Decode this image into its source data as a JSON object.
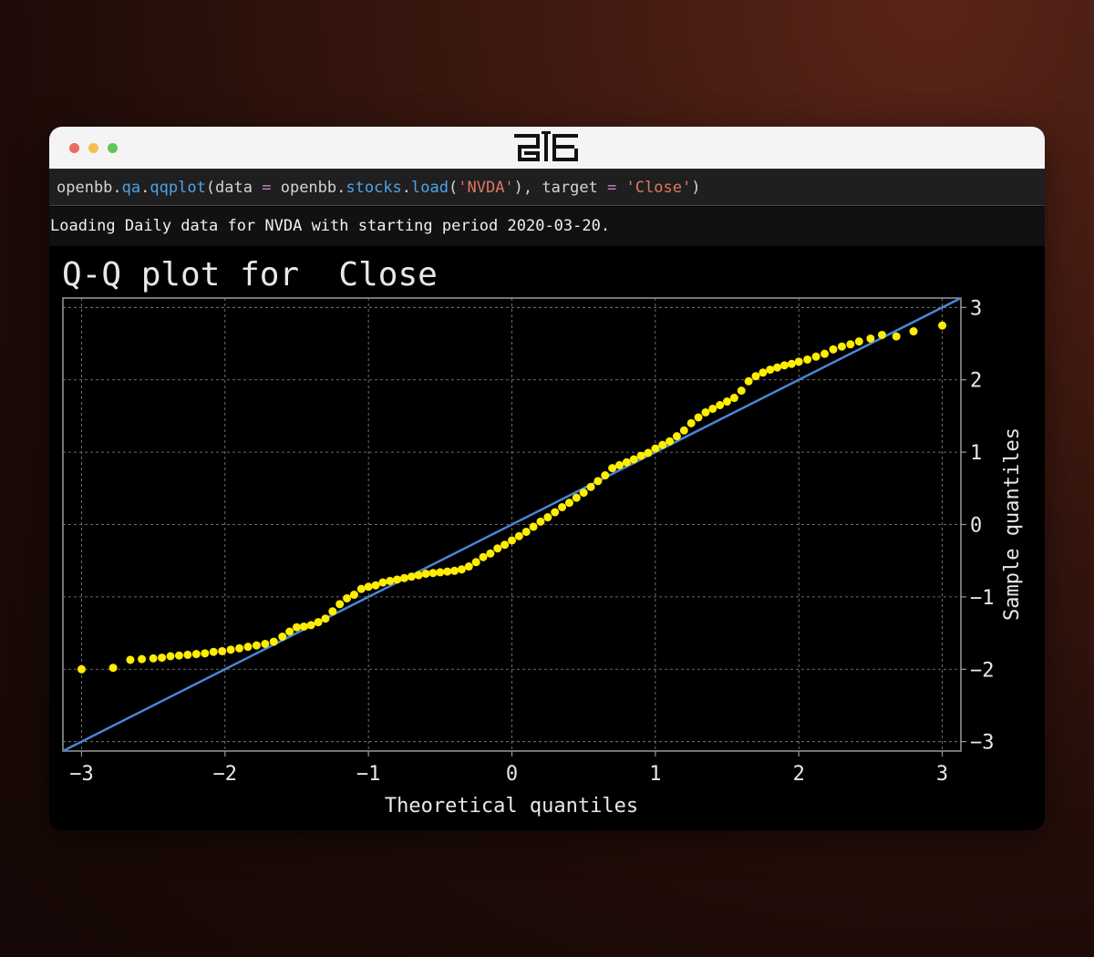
{
  "window": {
    "logo": "openbb-logo-icon"
  },
  "code": {
    "t1": "openbb.",
    "t2": "qa",
    "t3": ".",
    "t4": "qqplot",
    "t5": "(data ",
    "t6": "=",
    "t7": " openbb.",
    "t8": "stocks",
    "t9": ".",
    "t10": "load",
    "t11": "(",
    "t12": "'NVDA'",
    "t13": "), target ",
    "t14": "=",
    "t15": " ",
    "t16": "'Close'",
    "t17": ")"
  },
  "output": {
    "message": "Loading Daily data for NVDA with starting period 2020-03-20."
  },
  "colors": {
    "points": "#ffee00",
    "line": "#4a86d4",
    "grid": "#8a8a8a",
    "axis_text": "#e8e8e8"
  },
  "chart_data": {
    "type": "scatter",
    "title": "Q-Q plot for  Close",
    "xlabel": "Theoretical quantiles",
    "ylabel": "Sample quantiles",
    "xlim": [
      -3.13,
      3.13
    ],
    "ylim": [
      -3.13,
      3.13
    ],
    "xticks": [
      -3,
      -2,
      -1,
      0,
      1,
      2,
      3
    ],
    "yticks": [
      -3,
      -2,
      -1,
      0,
      1,
      2,
      3
    ],
    "xtick_labels": [
      "−3",
      "−2",
      "−1",
      "0",
      "1",
      "2",
      "3"
    ],
    "ytick_labels": [
      "−3",
      "−2",
      "−1",
      "0",
      "1",
      "2",
      "3"
    ],
    "grid": true,
    "y_axis_side": "right",
    "reference_line": {
      "x": [
        -3.13,
        3.13
      ],
      "y": [
        -3.13,
        3.13
      ]
    },
    "points": [
      [
        -3.0,
        -2.0
      ],
      [
        -2.78,
        -1.98
      ],
      [
        -2.66,
        -1.87
      ],
      [
        -2.58,
        -1.86
      ],
      [
        -2.5,
        -1.85
      ],
      [
        -2.44,
        -1.84
      ],
      [
        -2.38,
        -1.82
      ],
      [
        -2.32,
        -1.81
      ],
      [
        -2.26,
        -1.8
      ],
      [
        -2.2,
        -1.79
      ],
      [
        -2.14,
        -1.78
      ],
      [
        -2.08,
        -1.76
      ],
      [
        -2.02,
        -1.75
      ],
      [
        -1.96,
        -1.73
      ],
      [
        -1.9,
        -1.71
      ],
      [
        -1.84,
        -1.69
      ],
      [
        -1.78,
        -1.67
      ],
      [
        -1.72,
        -1.65
      ],
      [
        -1.66,
        -1.62
      ],
      [
        -1.6,
        -1.55
      ],
      [
        -1.55,
        -1.48
      ],
      [
        -1.5,
        -1.42
      ],
      [
        -1.45,
        -1.41
      ],
      [
        -1.4,
        -1.39
      ],
      [
        -1.35,
        -1.35
      ],
      [
        -1.3,
        -1.3
      ],
      [
        -1.25,
        -1.2
      ],
      [
        -1.2,
        -1.1
      ],
      [
        -1.15,
        -1.02
      ],
      [
        -1.1,
        -0.97
      ],
      [
        -1.05,
        -0.89
      ],
      [
        -1.0,
        -0.86
      ],
      [
        -0.95,
        -0.84
      ],
      [
        -0.9,
        -0.8
      ],
      [
        -0.85,
        -0.78
      ],
      [
        -0.8,
        -0.76
      ],
      [
        -0.75,
        -0.74
      ],
      [
        -0.7,
        -0.72
      ],
      [
        -0.65,
        -0.7
      ],
      [
        -0.6,
        -0.68
      ],
      [
        -0.55,
        -0.67
      ],
      [
        -0.5,
        -0.66
      ],
      [
        -0.45,
        -0.65
      ],
      [
        -0.4,
        -0.64
      ],
      [
        -0.35,
        -0.62
      ],
      [
        -0.3,
        -0.58
      ],
      [
        -0.25,
        -0.52
      ],
      [
        -0.2,
        -0.45
      ],
      [
        -0.15,
        -0.4
      ],
      [
        -0.1,
        -0.33
      ],
      [
        -0.05,
        -0.28
      ],
      [
        0.0,
        -0.22
      ],
      [
        0.05,
        -0.16
      ],
      [
        0.1,
        -0.1
      ],
      [
        0.15,
        -0.03
      ],
      [
        0.2,
        0.04
      ],
      [
        0.25,
        0.1
      ],
      [
        0.3,
        0.17
      ],
      [
        0.35,
        0.24
      ],
      [
        0.4,
        0.3
      ],
      [
        0.45,
        0.37
      ],
      [
        0.5,
        0.44
      ],
      [
        0.55,
        0.52
      ],
      [
        0.6,
        0.6
      ],
      [
        0.65,
        0.68
      ],
      [
        0.7,
        0.78
      ],
      [
        0.75,
        0.82
      ],
      [
        0.8,
        0.86
      ],
      [
        0.85,
        0.9
      ],
      [
        0.9,
        0.95
      ],
      [
        0.95,
        0.99
      ],
      [
        1.0,
        1.05
      ],
      [
        1.05,
        1.1
      ],
      [
        1.1,
        1.15
      ],
      [
        1.15,
        1.22
      ],
      [
        1.2,
        1.3
      ],
      [
        1.25,
        1.4
      ],
      [
        1.3,
        1.48
      ],
      [
        1.35,
        1.55
      ],
      [
        1.4,
        1.6
      ],
      [
        1.45,
        1.65
      ],
      [
        1.5,
        1.7
      ],
      [
        1.55,
        1.75
      ],
      [
        1.6,
        1.85
      ],
      [
        1.65,
        1.98
      ],
      [
        1.7,
        2.05
      ],
      [
        1.75,
        2.1
      ],
      [
        1.8,
        2.14
      ],
      [
        1.85,
        2.17
      ],
      [
        1.9,
        2.2
      ],
      [
        1.95,
        2.22
      ],
      [
        2.0,
        2.25
      ],
      [
        2.06,
        2.28
      ],
      [
        2.12,
        2.32
      ],
      [
        2.18,
        2.36
      ],
      [
        2.24,
        2.42
      ],
      [
        2.3,
        2.46
      ],
      [
        2.36,
        2.49
      ],
      [
        2.42,
        2.53
      ],
      [
        2.5,
        2.57
      ],
      [
        2.58,
        2.62
      ],
      [
        2.68,
        2.6
      ],
      [
        2.8,
        2.67
      ],
      [
        3.0,
        2.75
      ]
    ]
  }
}
